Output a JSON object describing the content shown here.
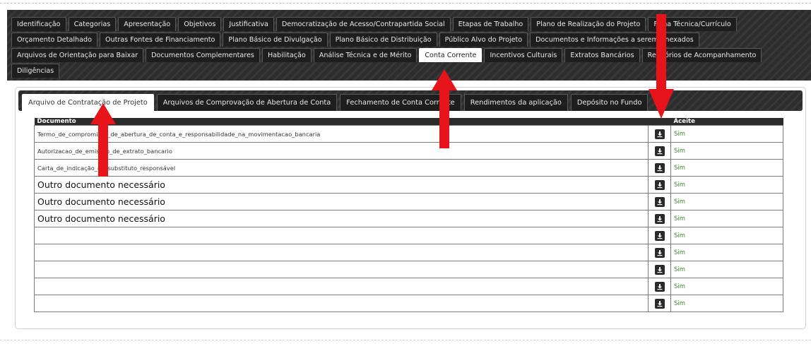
{
  "main_tabs": {
    "row1": [
      "Identificação",
      "Categorias",
      "Apresentação",
      "Objetivos",
      "Justificativa",
      "Democratização de Acesso/Contrapartida Social",
      "Etapas de Trabalho",
      "Plano de Realização do Projeto",
      "Ficha Técnica/Currículo"
    ],
    "row2": [
      "Orçamento Detalhado",
      "Outras Fontes de Financiamento",
      "Plano Básico de Divulgação",
      "Plano Básico de Distribuição",
      "Público Alvo do Projeto",
      "Documentos e Informações a serem Anexados"
    ],
    "row3": [
      "Arquivos de Orientação para Baixar",
      "Documentos Complementares",
      "Habilitação",
      "Análise Técnica e de Mérito",
      "Conta Corrente",
      "Incentivos Culturais",
      "Extratos Bancários",
      "Relatórios de Acompanhamento"
    ],
    "row4": [
      "Diligências"
    ],
    "active": "Conta Corrente"
  },
  "sub_tabs": {
    "items": [
      "Arquivo de Contratação de Projeto",
      "Arquivos de Comprovação de Abertura de Conta",
      "Fechamento de Conta Corrente",
      "Rendimentos da aplicação",
      "Depósito no Fundo"
    ],
    "active": "Arquivo de Contratação de Projeto"
  },
  "table": {
    "headers": {
      "documento": "Documento",
      "download": "",
      "aceite": "Aceite"
    },
    "rows": [
      {
        "documento": "Termo_de_compromisso_de_abertura_de_conta_e_responsabilidade_na_movimentacao_bancaria",
        "aceite": "Sim"
      },
      {
        "documento": "Autorizacao_de_emissao_de_extrato_bancario",
        "aceite": "Sim"
      },
      {
        "documento": "Carta_de_indicação_de_substituto_responsável",
        "aceite": "Sim"
      },
      {
        "documento": "Outro documento necessário",
        "aceite": "Sim"
      },
      {
        "documento": "Outro documento necessário",
        "aceite": "Sim"
      },
      {
        "documento": "Outro documento necessário",
        "aceite": "Sim"
      },
      {
        "documento": "",
        "aceite": "Sim"
      },
      {
        "documento": "",
        "aceite": "Sim"
      },
      {
        "documento": "",
        "aceite": "Sim"
      },
      {
        "documento": "",
        "aceite": "Sim"
      },
      {
        "documento": "",
        "aceite": "Sim"
      }
    ]
  },
  "icons": {
    "download": "download-icon",
    "arrow": "red-arrow"
  },
  "colors": {
    "tab_bar": "#2d2d2d",
    "active_tab": "#ffffff",
    "accept_text": "#3f8f2f",
    "arrow": "#e8141b"
  }
}
